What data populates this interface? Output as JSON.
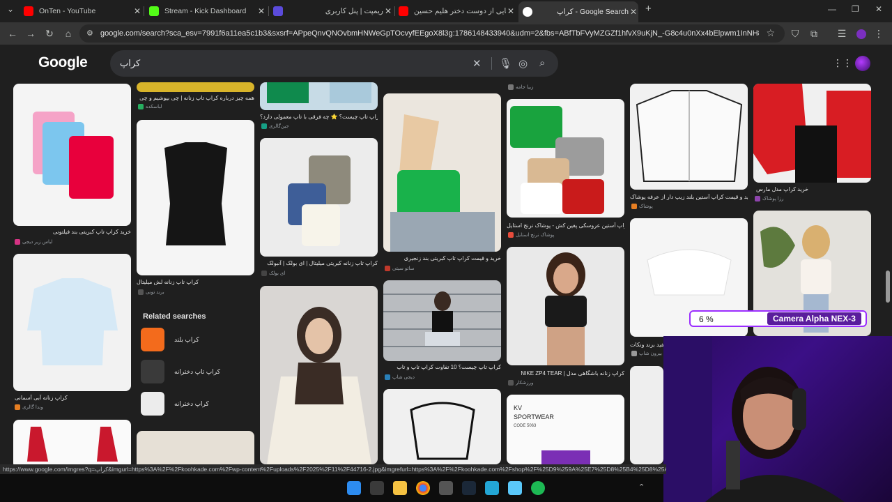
{
  "tabs": [
    {
      "title": "OnTen - YouTube",
      "color": "#ff0000"
    },
    {
      "title": "Stream - Kick Dashboard",
      "color": "#53fc18"
    },
    {
      "title": "ریمپت | پنل کاربری",
      "color": "#5b4bdb"
    },
    {
      "title": "رونمایی از دوست دختر هلیم حسین",
      "color": "#ff0000"
    },
    {
      "title": "کراپ - Google Search",
      "color": "#ffffff"
    }
  ],
  "address": {
    "url": "google.com/search?sca_esv=7991f6a11ea5c1b3&sxsrf=APpeQnvQNOvbmHNWeGpTOcvyfEEgoX8l3g:1786148433940&udm=2&fbs=ABfTbFVyMZGZf1hfvX9uKjN_-G8c4u0nXx4bElpwm1InNH832VTJOO..."
  },
  "google": {
    "logo": "Google",
    "query": "کراپ",
    "icons": {
      "clear": "close-icon",
      "voice": "microphone-icon",
      "lens": "lens-icon",
      "search": "search-icon"
    }
  },
  "results": [
    {
      "caption": "خرید کراپ تاپ کبریتی بند فیلتونی",
      "source": "لباس زیر دیجی"
    },
    {
      "caption": "همه چیز درباره کراپ تاپ زنانه | چی بپوشیم و چی",
      "source": "لباسکده"
    },
    {
      "caption": "کراپ تاپ زنانه لش میلیتال",
      "source": "برند تونی"
    },
    {
      "caption": "کراپ تاپ چیست؟ ⭐ چه فرقی با تاپ معمولی دارد؟",
      "source": "جین‌گالری"
    },
    {
      "caption": "کراپ تاپ زنانه کبریتی میلیتال | ای بولک | آنبولک",
      "source": "ای بولک"
    },
    {
      "caption": "خرید و قیمت کراپ تاپ کبریتی بند زنجیری",
      "source": "ساتو سیتی"
    },
    {
      "caption": "کراپ تاپ چیست؟ 10 تفاوت کراپ تاپ و تاپ",
      "source": "دیجی شاپ"
    },
    {
      "caption": "کراپ آستین عروسکی پفین کش - پوشاک نرنج استایل",
      "source": "پوشاک نرنج استایل"
    },
    {
      "caption": "NIKE ZP4 TEAR | کراپ زنانه باشگاهی مدل",
      "source": "ورزشکار"
    },
    {
      "caption": "خرید و قیمت کراپ آستین بلند زیپ دار از عرفه پوشاک",
      "source": "پوشاک"
    },
    {
      "caption": "خرید کراپ مدل مارس",
      "source": "رزا پوشاک"
    },
    {
      "caption": "کراپ زنانه آبی آسمانی",
      "source": "وندا گالری"
    },
    {
      "caption": "سفید برند ونکات",
      "source": "بیرون شاپ"
    }
  ],
  "related": {
    "title": "Related searches",
    "items": [
      "کراپ بلند",
      "کراپ تاپ دخترانه",
      "کراپ دخترانه"
    ]
  },
  "status_url": "https://www.google.com/imgres?q=کراپ&imgurl=https%3A%2F%2Fkoohkade.com%2Fwp-content%2Fuploads%2F2025%2F11%2F44716-2.jpg&imgrefurl=https%3A%2F%2Fkoohkade.com%2Fshop%2F%25D9%259A%25E7%25D8%25B4%25D8%25A7%25D8",
  "overlay": {
    "percent": "6 %",
    "name": "Camera Alpha NEX-3"
  }
}
